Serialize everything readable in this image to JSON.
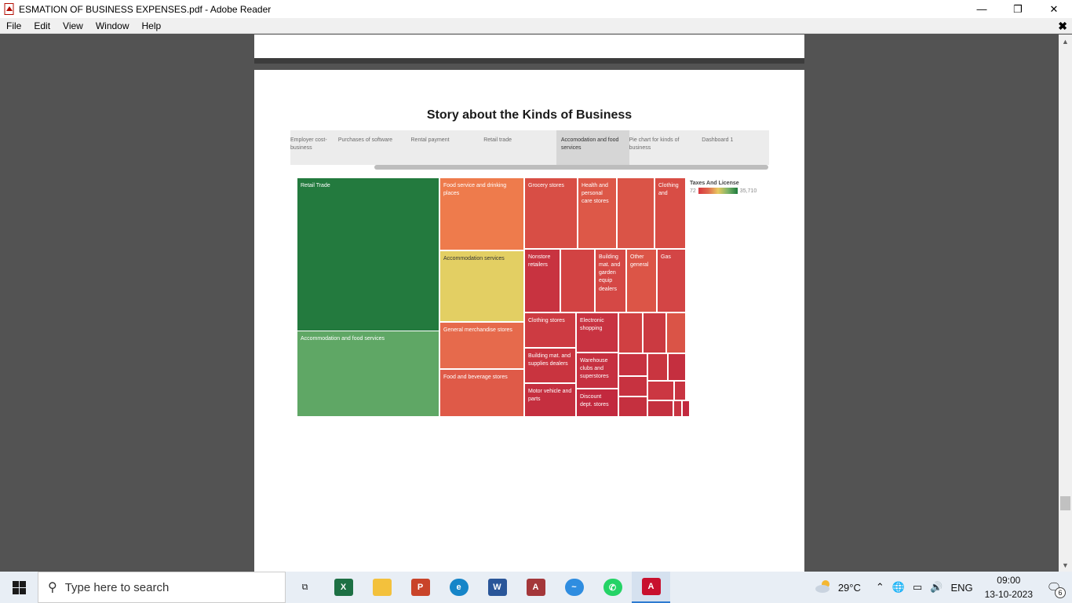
{
  "window": {
    "title": "ESMATION OF BUSINESS EXPENSES.pdf - Adobe Reader",
    "minimize": "—",
    "restore": "❐",
    "close": "✕"
  },
  "menu": {
    "items": [
      "File",
      "Edit",
      "View",
      "Window",
      "Help"
    ],
    "close": "✖"
  },
  "story": {
    "title": "Story about the Kinds of Business",
    "tabs": [
      "Employer cost-business",
      "Purchases of software",
      "Rental payment",
      "Retail trade",
      "Accomodation and food services",
      "Pie chart for kinds of business",
      "Dashboard 1"
    ],
    "selected_tab": "Accomodation and food services"
  },
  "legend": {
    "title": "Taxes And License",
    "min": "72",
    "max": "35,710"
  },
  "chart_data": {
    "type": "treemap",
    "measure": "Taxes And License",
    "color_range": [
      72,
      35710
    ],
    "labels": [
      "Retail Trade",
      "Accommodation and food services",
      "Food service and drinking places",
      "Accommodation services",
      "General merchandise stores",
      "Food and beverage stores",
      "Grocery stores",
      "Health and personal care stores",
      "Clothing and",
      "Nonstore retailers",
      "Building mat. and garden equip dealers",
      "Other general",
      "Gas",
      "Clothing stores",
      "Electronic shopping",
      "Building mat. and supplies dealers",
      "Warehouse clubs and superstores",
      "Motor vehicle and parts",
      "Discount dept. stores"
    ]
  },
  "taskbar": {
    "search_placeholder": "Type here to search",
    "temperature": "29°C",
    "language": "ENG",
    "time": "09:00",
    "date": "13-10-2023",
    "notifications": "6"
  }
}
